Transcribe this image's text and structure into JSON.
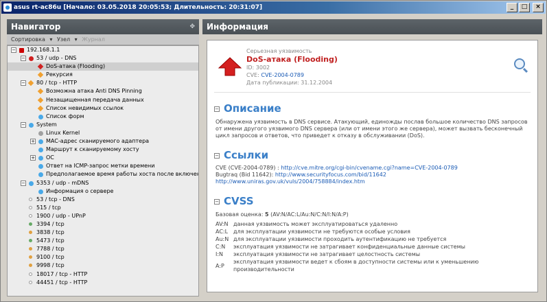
{
  "window": {
    "title": "asus rt-ac86u [Начало: 03.05.2018 20:05:53; Длительность: 20:31:07]"
  },
  "nav": {
    "title": "Навигатор",
    "toolbar": {
      "sort": "Сортировка",
      "node": "Узел",
      "journal": "Журнал"
    },
    "tree": [
      {
        "label": "192.168.1.1",
        "level": 0,
        "icon": "host",
        "exp": "-"
      },
      {
        "label": "53 / udp - DNS",
        "level": 1,
        "icon": "red",
        "exp": "-"
      },
      {
        "label": "DoS-атака (Flooding)",
        "level": 2,
        "icon": "pin-r",
        "selected": true
      },
      {
        "label": "Рекурсия",
        "level": 2,
        "icon": "orange"
      },
      {
        "label": "80 / tcp - HTTP",
        "level": 1,
        "icon": "orange",
        "exp": "-"
      },
      {
        "label": "Возможна атака Anti DNS Pinning",
        "level": 2,
        "icon": "orange"
      },
      {
        "label": "Незащищенная передача данных",
        "level": 2,
        "icon": "orange"
      },
      {
        "label": "Список невидимых ссылок",
        "level": 2,
        "icon": "orange"
      },
      {
        "label": "Список форм",
        "level": 2,
        "icon": "blue"
      },
      {
        "label": "System",
        "level": 1,
        "icon": "blue",
        "exp": "-"
      },
      {
        "label": "Linux Kernel",
        "level": 2,
        "icon": "gray"
      },
      {
        "label": "MAC-адрес сканируемого адаптера",
        "level": 2,
        "icon": "blue",
        "exp": "+"
      },
      {
        "label": "Маршрут к сканируемому хосту",
        "level": 2,
        "icon": "blue"
      },
      {
        "label": "ОС",
        "level": 2,
        "icon": "blue",
        "exp": "+"
      },
      {
        "label": "Ответ на ICMP-запрос метки времени",
        "level": 2,
        "icon": "blue"
      },
      {
        "label": "Предполагаемое время работы хоста после включения",
        "level": 2,
        "icon": "blue"
      },
      {
        "label": "5353 / udp - mDNS",
        "level": 1,
        "icon": "blue",
        "exp": "-"
      },
      {
        "label": "Информация о сервере",
        "level": 2,
        "icon": "blue"
      },
      {
        "label": "53 / tcp - DNS",
        "level": 1,
        "icon": "dot-w"
      },
      {
        "label": "515 / tcp",
        "level": 1,
        "icon": "dot-w"
      },
      {
        "label": "1900 / udp - UPnP",
        "level": 1,
        "icon": "dot-w"
      },
      {
        "label": "3394 / tcp",
        "level": 1,
        "icon": "dot-g"
      },
      {
        "label": "3838 / tcp",
        "level": 1,
        "icon": "dot-o"
      },
      {
        "label": "5473 / tcp",
        "level": 1,
        "icon": "dot-g"
      },
      {
        "label": "7788 / tcp",
        "level": 1,
        "icon": "dot-o"
      },
      {
        "label": "9100 / tcp",
        "level": 1,
        "icon": "dot-o"
      },
      {
        "label": "9998 / tcp",
        "level": 1,
        "icon": "dot-o"
      },
      {
        "label": "18017 / tcp - HTTP",
        "level": 1,
        "icon": "dot-w"
      },
      {
        "label": "44451 / tcp - HTTP",
        "level": 1,
        "icon": "dot-w"
      }
    ]
  },
  "info": {
    "title": "Информация",
    "severity": "Серьезная уязвимость",
    "vuln_title": "DoS-атака (Flooding)",
    "id_label": "ID: 3002",
    "cve_label": "CVE:",
    "cve_value": "CVE-2004-0789",
    "pub_date": "Дата публикации: 31.12.2004",
    "desc_heading": "Описание",
    "desc_text": "Обнаружена уязвимость в DNS сервисе. Атакующий, единожды послав большое количество DNS запросов от имени другого уязвимого DNS сервера (или от имени этого же сервера), может вызвать бесконечный цикл запросов и ответов, что приведет к отказу в обслуживании (DoS).",
    "links_heading": "Ссылки",
    "links": [
      {
        "prefix": "CVE (CVE-2004-0789) : ",
        "url": "http://cve.mitre.org/cgi-bin/cvename.cgi?name=CVE-2004-0789"
      },
      {
        "prefix": "Bugtraq (Bid 11642): ",
        "url": "http://www.securityfocus.com/bid/11642"
      },
      {
        "prefix": "",
        "url": "http://www.uniras.gov.uk/vuls/2004/758884/index.htm"
      }
    ],
    "cvss_heading": "CVSS",
    "cvss_score_label": "Базовая оценка:",
    "cvss_score": "5",
    "cvss_vector": "(AV:N/AC:L/Au:N/C:N/I:N/A:P)",
    "cvss_rows": [
      {
        "k": "AV:N",
        "v": "данная уязвимость может эксплуатироваться удаленно"
      },
      {
        "k": "AC:L",
        "v": "для эксплуатации уязвимости не требуются особые условия"
      },
      {
        "k": "Au:N",
        "v": "для эксплуатации уязвимости проходить аутентификацию не требуется"
      },
      {
        "k": "C:N",
        "v": "эксплуатация уязвимости не затрагивает конфиденциальные данные системы"
      },
      {
        "k": "I:N",
        "v": "эксплуатация уязвимости не затрагивает целостность системы"
      },
      {
        "k": "A:P",
        "v": "эксплуатация уязвимости ведет к сбоям в доступности системы или к уменьшению производительности"
      }
    ]
  }
}
